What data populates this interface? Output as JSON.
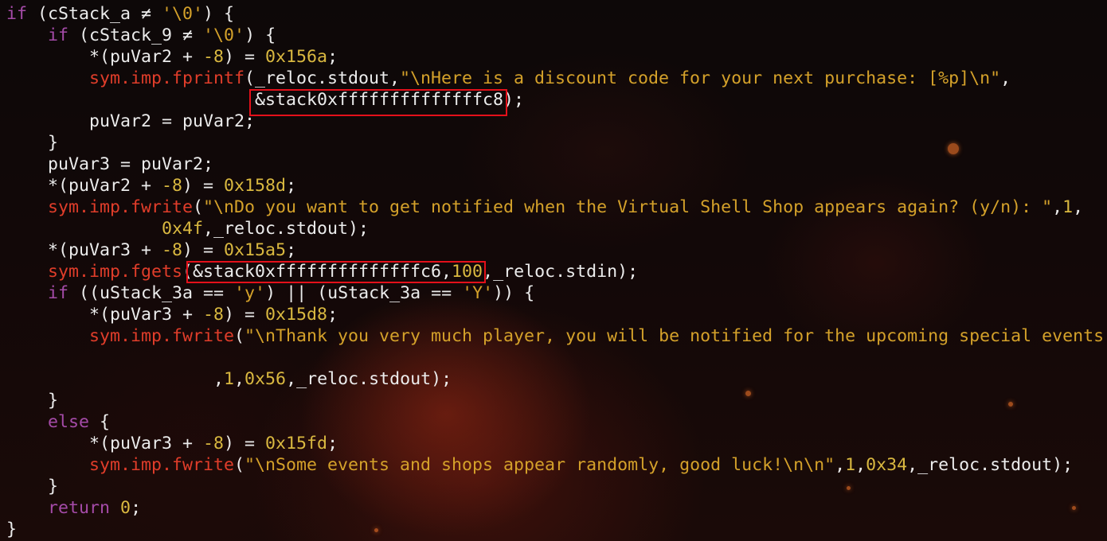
{
  "code_lines": [
    [
      {
        "t": "if",
        "c": "kw"
      },
      {
        "t": " (cStack_a ≠ ",
        "c": "default"
      },
      {
        "t": "'\\0'",
        "c": "str"
      },
      {
        "t": ") {",
        "c": "default"
      }
    ],
    [
      {
        "t": "    ",
        "c": "default"
      },
      {
        "t": "if",
        "c": "kw"
      },
      {
        "t": " (cStack_9 ≠ ",
        "c": "default"
      },
      {
        "t": "'\\0'",
        "c": "str"
      },
      {
        "t": ") {",
        "c": "default"
      }
    ],
    [
      {
        "t": "        *(puVar2 + ",
        "c": "default"
      },
      {
        "t": "-8",
        "c": "num"
      },
      {
        "t": ") = ",
        "c": "default"
      },
      {
        "t": "0x156a",
        "c": "num"
      },
      {
        "t": ";",
        "c": "default"
      }
    ],
    [
      {
        "t": "        ",
        "c": "default"
      },
      {
        "t": "sym.imp.fprintf",
        "c": "fn"
      },
      {
        "t": "(_reloc.stdout,",
        "c": "default"
      },
      {
        "t": "\"\\nHere is a discount code for your next purchase: [%p]\\n\"",
        "c": "str"
      },
      {
        "t": ",",
        "c": "default"
      }
    ],
    [
      {
        "t": "                        &stack0xffffffffffffffc8);",
        "c": "default"
      }
    ],
    [
      {
        "t": "        puVar2 = puVar2;",
        "c": "default"
      }
    ],
    [
      {
        "t": "    }",
        "c": "default"
      }
    ],
    [
      {
        "t": "    puVar3 = puVar2;",
        "c": "default"
      }
    ],
    [
      {
        "t": "    *(puVar2 + ",
        "c": "default"
      },
      {
        "t": "-8",
        "c": "num"
      },
      {
        "t": ") = ",
        "c": "default"
      },
      {
        "t": "0x158d",
        "c": "num"
      },
      {
        "t": ";",
        "c": "default"
      }
    ],
    [
      {
        "t": "    ",
        "c": "default"
      },
      {
        "t": "sym.imp.fwrite",
        "c": "fn"
      },
      {
        "t": "(",
        "c": "default"
      },
      {
        "t": "\"\\nDo you want to get notified when the Virtual Shell Shop appears again? (y/n): \"",
        "c": "str"
      },
      {
        "t": ",",
        "c": "default"
      },
      {
        "t": "1",
        "c": "num"
      },
      {
        "t": ",",
        "c": "default"
      }
    ],
    [
      {
        "t": "               ",
        "c": "default"
      },
      {
        "t": "0x4f",
        "c": "num"
      },
      {
        "t": ",_reloc.stdout);",
        "c": "default"
      }
    ],
    [
      {
        "t": "    *(puVar3 + ",
        "c": "default"
      },
      {
        "t": "-8",
        "c": "num"
      },
      {
        "t": ") = ",
        "c": "default"
      },
      {
        "t": "0x15a5",
        "c": "num"
      },
      {
        "t": ";",
        "c": "default"
      }
    ],
    [
      {
        "t": "    ",
        "c": "default"
      },
      {
        "t": "sym.imp.fgets",
        "c": "fn"
      },
      {
        "t": "(&stack0xffffffffffffffc6,",
        "c": "default"
      },
      {
        "t": "100",
        "c": "num"
      },
      {
        "t": ",_reloc.stdin);",
        "c": "default"
      }
    ],
    [
      {
        "t": "    ",
        "c": "default"
      },
      {
        "t": "if",
        "c": "kw"
      },
      {
        "t": " ((uStack_3a == ",
        "c": "default"
      },
      {
        "t": "'y'",
        "c": "str"
      },
      {
        "t": ") || (uStack_3a == ",
        "c": "default"
      },
      {
        "t": "'Y'",
        "c": "str"
      },
      {
        "t": ")) {",
        "c": "default"
      }
    ],
    [
      {
        "t": "        *(puVar3 + ",
        "c": "default"
      },
      {
        "t": "-8",
        "c": "num"
      },
      {
        "t": ") = ",
        "c": "default"
      },
      {
        "t": "0x15d8",
        "c": "num"
      },
      {
        "t": ";",
        "c": "default"
      }
    ],
    [
      {
        "t": "        ",
        "c": "default"
      },
      {
        "t": "sym.imp.fwrite",
        "c": "fn"
      },
      {
        "t": "(",
        "c": "default"
      },
      {
        "t": "\"\\nThank you very much player, you will be notified for the upcoming special events",
        "c": "str"
      }
    ],
    [
      {
        "t": "",
        "c": "default"
      }
    ],
    [
      {
        "t": "                    ,",
        "c": "default"
      },
      {
        "t": "1",
        "c": "num"
      },
      {
        "t": ",",
        "c": "default"
      },
      {
        "t": "0x56",
        "c": "num"
      },
      {
        "t": ",_reloc.stdout);",
        "c": "default"
      }
    ],
    [
      {
        "t": "    }",
        "c": "default"
      }
    ],
    [
      {
        "t": "    ",
        "c": "default"
      },
      {
        "t": "else",
        "c": "kw"
      },
      {
        "t": " {",
        "c": "default"
      }
    ],
    [
      {
        "t": "        *(puVar3 + ",
        "c": "default"
      },
      {
        "t": "-8",
        "c": "num"
      },
      {
        "t": ") = ",
        "c": "default"
      },
      {
        "t": "0x15fd",
        "c": "num"
      },
      {
        "t": ";",
        "c": "default"
      }
    ],
    [
      {
        "t": "        ",
        "c": "default"
      },
      {
        "t": "sym.imp.fwrite",
        "c": "fn"
      },
      {
        "t": "(",
        "c": "default"
      },
      {
        "t": "\"\\nSome events and shops appear randomly, good luck!\\n\\n\"",
        "c": "str"
      },
      {
        "t": ",",
        "c": "default"
      },
      {
        "t": "1",
        "c": "num"
      },
      {
        "t": ",",
        "c": "default"
      },
      {
        "t": "0x34",
        "c": "num"
      },
      {
        "t": ",_reloc.stdout);",
        "c": "default"
      }
    ],
    [
      {
        "t": "    }",
        "c": "default"
      }
    ],
    [
      {
        "t": "    ",
        "c": "default"
      },
      {
        "t": "return",
        "c": "kw"
      },
      {
        "t": " ",
        "c": "default"
      },
      {
        "t": "0",
        "c": "num"
      },
      {
        "t": ";",
        "c": "default"
      }
    ],
    [
      {
        "t": "}",
        "c": "default"
      }
    ]
  ],
  "colors": {
    "default": "#ececec",
    "keyword": "#a54ba8",
    "function": "#e03d2a",
    "string": "#d4a12a",
    "number": "#d9b840",
    "highlight_box": "#e4101a",
    "background": "#0b0707"
  }
}
